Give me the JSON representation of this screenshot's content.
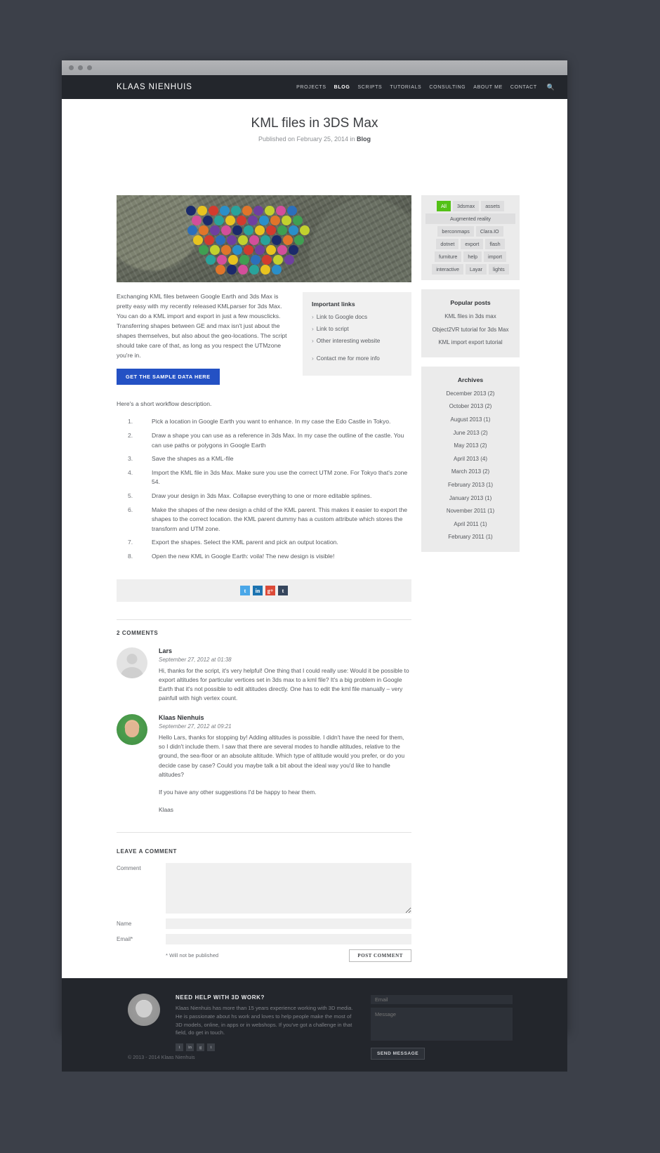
{
  "browser": {
    "dots": 3
  },
  "header": {
    "brand": "KLAAS NIENHUIS",
    "nav": [
      {
        "label": "PROJECTS",
        "active": false
      },
      {
        "label": "BLOG",
        "active": true
      },
      {
        "label": "SCRIPTS",
        "active": false
      },
      {
        "label": "TUTORIALS",
        "active": false
      },
      {
        "label": "CONSULTING",
        "active": false
      },
      {
        "label": "ABOUT ME",
        "active": false
      },
      {
        "label": "CONTACT",
        "active": false
      }
    ],
    "search_icon": "search-icon"
  },
  "post": {
    "title": "KML files in 3DS Max",
    "meta_prefix": "Published on February 25, 2014 in ",
    "meta_category": "Blog",
    "intro": "Exchanging KML files between Google Earth and 3ds Max is pretty easy with my recently released KMLparser for 3ds Max. You can do a KML import and export in just a few mousclicks. Transferring shapes between GE and max isn't just about the shapes themselves, but also about the geo-locations. The script should take care of that, as long as you respect the UTMzone you're in.",
    "sample_button": "GET THE SAMPLE DATA HERE",
    "workflow_intro": "Here's a short workflow description.",
    "steps": [
      "Pick a location in Google Earth you want to enhance. In my case the Edo Castle in Tokyo.",
      "Draw a shape you can use as a reference in 3ds Max. In my case the outline of the castle. You can use paths or polygons in Google Earth",
      "Save the shapes as a KML-file",
      "Import the KML file in 3ds Max. Make sure you use the correct UTM zone. For Tokyo that's zone 54.",
      "Draw your design in 3ds Max. Collapse everything to one or more editable splines.",
      "Make the shapes of the new design a child of the KML parent. This makes it easier to export the shapes to the correct location. the KML parent dummy has a custom attribute which stores the transform and UTM zone.",
      "Export the shapes. Select the KML parent and pick an output location.",
      "Open the new KML in Google Earth: voila! The new design is visible!"
    ]
  },
  "important_links": {
    "title": "Important links",
    "items": [
      "Link to Google docs",
      "Link to script",
      "Other interesting website"
    ],
    "contact": "Contact me for more info"
  },
  "share": {
    "icons": [
      {
        "name": "twitter-icon",
        "glyph": "t",
        "color": "#4aa7e8"
      },
      {
        "name": "linkedin-icon",
        "glyph": "in",
        "color": "#1c73b0"
      },
      {
        "name": "google-plus-icon",
        "glyph": "g+",
        "color": "#dc4a38"
      },
      {
        "name": "tumblr-icon",
        "glyph": "t",
        "color": "#36465d"
      }
    ]
  },
  "comments": {
    "count_label": "2 COMMENTS",
    "items": [
      {
        "author": "Lars",
        "date": "September 27, 2012 at 01:38",
        "avatar": "placeholder-avatar",
        "paragraphs": [
          "Hi, thanks for the script, it's very helpful!\nOne thing that I could really use: Would it be possible to export altitudes for particular vertices set in 3ds max to a kml file? It's a big problem in Google Earth that it's not possible to edit altitudes directly. One has to edit the kml file manually – very painfull with high vertex count."
        ]
      },
      {
        "author": "Klaas Nienhuis",
        "date": "September 27, 2012 at 09:21",
        "avatar": "klaas-avatar",
        "paragraphs": [
          "Hello Lars, thanks for stopping by! Adding altitudes is possible. I didn't have the need for them, so I didn't include them. I saw that there are several modes to handle altitudes, relative to the ground, the sea-floor or an absolute altitude. Which type of altitude would you prefer, or do you decide case by case? Could you maybe talk a bit about the ideal way you'd like to handle altitudes?",
          "If you have any other suggestions I'd be happy to hear them.",
          "Klaas"
        ]
      }
    ]
  },
  "comment_form": {
    "heading": "LEAVE A COMMENT",
    "comment_label": "Comment",
    "name_label": "Name",
    "email_label": "Email*",
    "comment_value": "",
    "name_value": "",
    "email_value": "",
    "note": "* Will not be published",
    "submit_label": "POST COMMENT"
  },
  "sidebar": {
    "tags": [
      {
        "label": "All",
        "active": true,
        "wide": false
      },
      {
        "label": "3dsmax",
        "active": false,
        "wide": false
      },
      {
        "label": "assets",
        "active": false,
        "wide": false
      },
      {
        "label": "Augmented reality",
        "active": false,
        "wide": true
      },
      {
        "label": "berconmaps",
        "active": false,
        "wide": false
      },
      {
        "label": "Clara.IO",
        "active": false,
        "wide": false
      },
      {
        "label": "dotnet",
        "active": false,
        "wide": false
      },
      {
        "label": "export",
        "active": false,
        "wide": false
      },
      {
        "label": "flash",
        "active": false,
        "wide": false
      },
      {
        "label": "furniture",
        "active": false,
        "wide": false
      },
      {
        "label": "help",
        "active": false,
        "wide": false
      },
      {
        "label": "import",
        "active": false,
        "wide": false
      },
      {
        "label": "interactive",
        "active": false,
        "wide": false
      },
      {
        "label": "Layar",
        "active": false,
        "wide": false
      },
      {
        "label": "lights",
        "active": false,
        "wide": false
      }
    ],
    "popular": {
      "title": "Popular posts",
      "items": [
        "KML files in 3ds max",
        "Object2VR tutorial for 3ds Max",
        "KML import export tutorial"
      ]
    },
    "archives": {
      "title": "Archives",
      "items": [
        "December 2013 (2)",
        "October 2013 (2)",
        "August 2013 (1)",
        "June 2013 (2)",
        "May 2013 (2)",
        "April 2013 (4)",
        "March 2013 (2)",
        "February 2013 (1)",
        "January 2013 (1)",
        "November 2011 (1)",
        "April 2011 (1)",
        "February 2011 (1)"
      ]
    }
  },
  "footer": {
    "heading": "NEED HELP WITH 3D WORK?",
    "body": "Klaas Nienhuis has more than 15 years experience working with 3D media. He is passionate about hs work and loves to help people make the most of 3D models, online, in apps or in webshops. If you've got a challenge in that field, do get in touch.",
    "social": [
      {
        "name": "twitter-icon",
        "glyph": "t"
      },
      {
        "name": "linkedin-icon",
        "glyph": "in"
      },
      {
        "name": "google-plus-icon",
        "glyph": "g"
      },
      {
        "name": "tumblr-icon",
        "glyph": "t"
      }
    ],
    "copyright": "© 2013 - 2014 Klaas Nienhuis",
    "email_placeholder": "Email",
    "message_placeholder": "Message",
    "send_label": "SEND MESSAGE"
  }
}
